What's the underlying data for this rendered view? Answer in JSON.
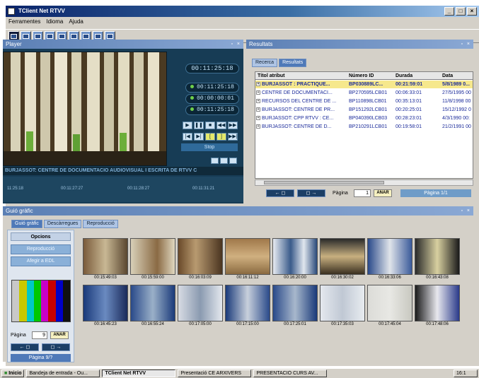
{
  "window": {
    "title": "TClient Net RTVV"
  },
  "menu": [
    "Ferramentes",
    "Idioma",
    "Ajuda"
  ],
  "player": {
    "title": "Player",
    "tc_main": "00:11:25:18",
    "tc_in": "00:11:25:18",
    "tc_dur": "00:00:00:01",
    "tc_out": "00:11:25:18",
    "stop_label": "Stop",
    "caption": "BURJASSOT: CENTRE DE DOCUMENTACIO AUDIOVISUAL I ESCRITA DE RTVV C",
    "timeline_times": [
      "11:25:18",
      "00:11:27:27",
      "00:11:28:27",
      "00:11:31:21"
    ]
  },
  "results": {
    "title": "Resultats",
    "tabs": [
      "Recerca",
      "Resultats"
    ],
    "columns": [
      "Títol atribut",
      "Número ID",
      "Durada",
      "Data"
    ],
    "rows": [
      [
        "BURJASSOT : PRACTIQUE...",
        "BP030889LC...",
        "00:21:59:01",
        "5/8/1989 0..."
      ],
      [
        "CENTRE DE DOCUMENTACI...",
        "BP270595LCB01",
        "00:06:33:01",
        "27/5/1995 00"
      ],
      [
        "RECURSOS DEL CENTRE DE ...",
        "BP110898LCB01",
        "00:35:13:01",
        "11/8/1998 00"
      ],
      [
        "BURJASSOT: CENTRE DE PR...",
        "BP151292LCB01",
        "00:20:25:01",
        "15/12/1992 0"
      ],
      [
        "BURJASSOT: CPP RTVV : CE...",
        "BP040390LCB03",
        "00:28:23:01",
        "4/3/1990 00:"
      ],
      [
        "BURJASSOT: CENTRE DE D...",
        "BP210291LCB01",
        "00:19:58:01",
        "21/2/1991 00"
      ]
    ],
    "page_label": "Pàgina",
    "page_value": "1",
    "go_label": "ANAR",
    "page_info": "Pàgina 1/1"
  },
  "guide": {
    "title": "Guió gràfic",
    "tabs": [
      "Guió gràfic",
      "Descàrregues",
      "Reproducció"
    ],
    "options_title": "Opcions",
    "btn_reproduccio": "Reproducció",
    "btn_edl": "Afegir a EDL",
    "page_label": "Pàgina",
    "page_value": "9",
    "go_label": "ANAR",
    "page_info": "Pàgina 9/?",
    "thumbs": [
      "00:15:49:03",
      "00:15:59:00",
      "00:16:03:09",
      "00:16:11:12",
      "00:16:20:00",
      "00:16:30:02",
      "00:16:33:06",
      "00:16:43:08",
      "00:16:45:23",
      "00:16:55:24",
      "00:17:05:00",
      "00:17:15:00",
      "00:17:25:01",
      "00:17:35:03",
      "00:17:45:04",
      "00:17:48:06"
    ]
  },
  "taskbar": {
    "start": "Inicio",
    "items": [
      "Bandeja de entrada - Ou...",
      "TClient Net RTVV",
      "Presentació CE ARXIVERS",
      "PRESENTACIÓ CURS AV..."
    ],
    "clock": "16:1"
  }
}
